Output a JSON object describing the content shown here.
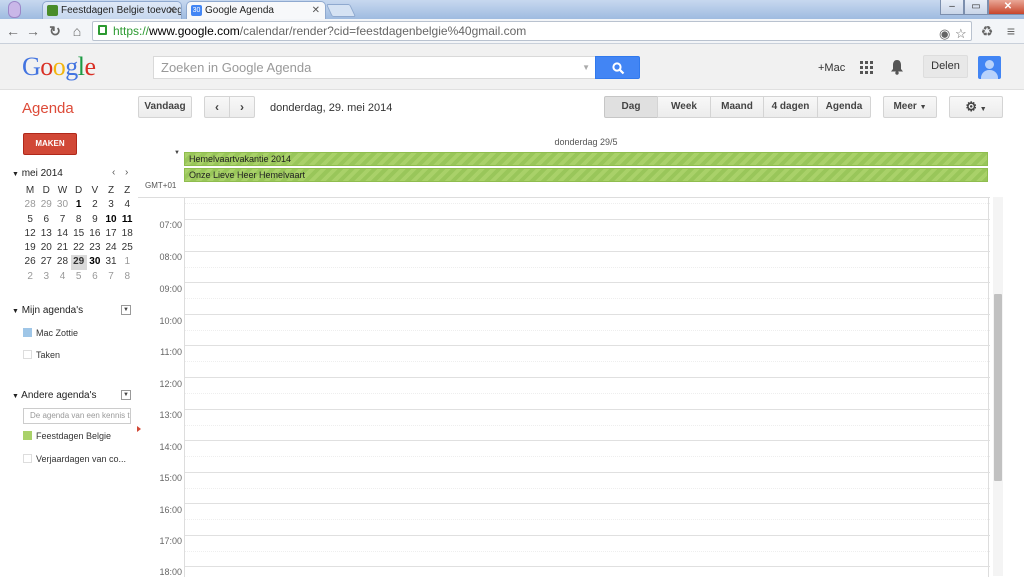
{
  "browser": {
    "tabs": [
      {
        "title": "Feestdagen Belgie toevoeg",
        "favicon_color": "#4a8c2a"
      },
      {
        "title": "Google Agenda",
        "favicon_label": "30",
        "favicon_color": "#4285f4"
      }
    ],
    "url": {
      "scheme": "https://",
      "host": "www.google.com",
      "path": "/calendar/render?cid=feestdagenbelgie%40gmail.com"
    }
  },
  "gbar": {
    "logo_letters": [
      "G",
      "o",
      "o",
      "g",
      "l",
      "e"
    ],
    "search_placeholder": "Zoeken in Google Agenda",
    "user_link": "+Mac",
    "share_label": "Delen"
  },
  "header": {
    "app_title": "Agenda",
    "today_label": "Vandaag",
    "date_range": "donderdag, 29. mei 2014",
    "views": [
      "Dag",
      "Week",
      "Maand",
      "4 dagen",
      "Agenda"
    ],
    "selected_view": "Dag",
    "more_label": "Meer"
  },
  "sidebar": {
    "create_label": "MAKEN",
    "mini_month": "mei 2014",
    "weekday_headers": [
      "M",
      "D",
      "W",
      "D",
      "V",
      "Z",
      "Z"
    ],
    "weeks": [
      [
        "28",
        "29",
        "30",
        "1",
        "2",
        "3",
        "4"
      ],
      [
        "5",
        "6",
        "7",
        "8",
        "9",
        "10",
        "11"
      ],
      [
        "12",
        "13",
        "14",
        "15",
        "16",
        "17",
        "18"
      ],
      [
        "19",
        "20",
        "21",
        "22",
        "23",
        "24",
        "25"
      ],
      [
        "26",
        "27",
        "28",
        "29",
        "30",
        "31",
        "1"
      ],
      [
        "2",
        "3",
        "4",
        "5",
        "6",
        "7",
        "8"
      ]
    ],
    "my_calendars_title": "Mijn agenda's",
    "my_calendars": [
      {
        "name": "Mac Zottie",
        "color": "#9fc6e7"
      },
      {
        "name": "Taken",
        "color": ""
      }
    ],
    "other_calendars_title": "Andere agenda's",
    "add_friend_placeholder": "De agenda van een kennis t",
    "other_calendars": [
      {
        "name": "Feestdagen Belgie",
        "color": "#a9d169"
      },
      {
        "name": "Verjaardagen van co...",
        "color": ""
      }
    ]
  },
  "day_view": {
    "day_header": "donderdag 29/5",
    "timezone": "GMT+01",
    "all_day_events": [
      {
        "title": "Hemelvaartvakantie 2014",
        "color": "#a9d169"
      },
      {
        "title": "Onze Lieve Heer Hemelvaart",
        "color": "#a9d169"
      }
    ],
    "hours": [
      "07:00",
      "08:00",
      "09:00",
      "10:00",
      "11:00",
      "12:00",
      "13:00",
      "14:00",
      "15:00",
      "16:00",
      "17:00",
      "18:00"
    ]
  }
}
